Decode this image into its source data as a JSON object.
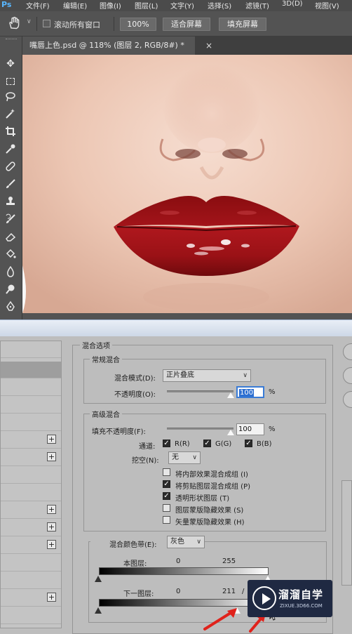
{
  "app": {
    "logo": "Ps",
    "menu": [
      "文件(F)",
      "编辑(E)",
      "图像(I)",
      "图层(L)",
      "文字(Y)",
      "选择(S)",
      "滤镜(T)",
      "3D(D)",
      "视图(V)"
    ]
  },
  "options_bar": {
    "scroll_all_label": "滚动所有窗口",
    "zoom_100": "100%",
    "fit_screen": "适合屏幕",
    "fill_screen": "填充屏幕"
  },
  "document": {
    "tab_title": "嘴唇上色.psd @ 118% (图层 2, RGB/8#) *",
    "close": "×"
  },
  "tools": [
    "move-icon",
    "marquee-icon",
    "lasso-icon",
    "magic-wand-icon",
    "crop-icon",
    "eyedropper-icon",
    "healing-icon",
    "brush-icon",
    "stamp-icon",
    "history-brush-icon",
    "eraser-icon",
    "paint-bucket-icon",
    "blur-icon",
    "dodge-icon",
    "pen-icon"
  ],
  "blend_options": {
    "title": "混合选项",
    "general": {
      "title": "常规混合",
      "mode_label": "混合模式(D):",
      "mode_value": "正片叠底",
      "opacity_label": "不透明度(O):",
      "opacity_value": "100",
      "percent": "%",
      "opacity_level": 1.0
    },
    "advanced": {
      "title": "高级混合",
      "fill_label": "填充不透明度(F):",
      "fill_value": "100",
      "percent": "%",
      "fill_level": 1.0,
      "channels_label": "通道:",
      "channel_r": "R(R)",
      "channel_g": "G(G)",
      "channel_b": "B(B)",
      "knockout_label": "挖空(N):",
      "knockout_value": "无",
      "options": [
        {
          "label": "将内部效果混合成组 (I)",
          "checked": false
        },
        {
          "label": "将剪贴图层混合成组 (P)",
          "checked": true
        },
        {
          "label": "透明形状图层 (T)",
          "checked": true
        },
        {
          "label": "图层蒙版隐藏效果 (S)",
          "checked": false
        },
        {
          "label": "矢量蒙版隐藏效果 (H)",
          "checked": false
        }
      ]
    },
    "blend_if": {
      "label": "混合颜色带(E):",
      "value": "灰色",
      "this_layer_label": "本图层:",
      "this_layer_low": "0",
      "this_layer_high": "255",
      "underlying_label": "下一图层:",
      "underlying_low": "0",
      "underlying_high": "211",
      "underlying_split": "/"
    }
  },
  "watermark": {
    "title": "溜溜自学",
    "subtitle": "ZIXUE.3D66.COM"
  },
  "colors": {
    "lip": "#9b0f12",
    "arrow": "#e0221b",
    "selection": "#2d6fd1"
  }
}
